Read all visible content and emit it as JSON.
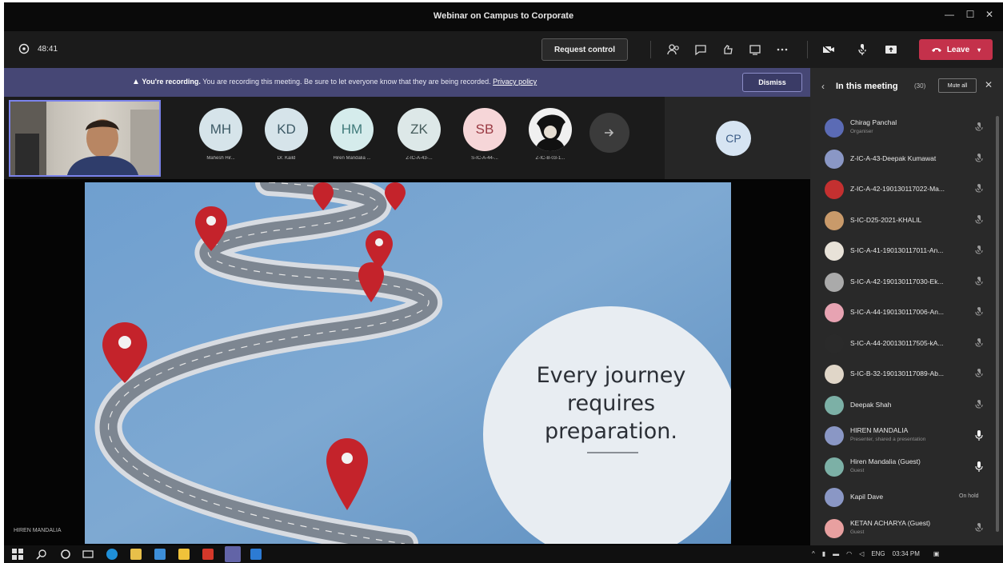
{
  "window": {
    "title": "Webinar on Campus to Corporate",
    "controls": [
      "—",
      "☐",
      "✕"
    ]
  },
  "toolbar": {
    "timer": "48:41",
    "request_control": "Request control",
    "leave": "Leave"
  },
  "banner": {
    "bold": "You're recording.",
    "message": "You are recording this meeting. Be sure to let everyone know that they are being recorded.",
    "link": "Privacy policy",
    "dismiss": "Dismiss"
  },
  "strip": {
    "participants": [
      {
        "initials": "MH",
        "name": "Mahesh Hir...",
        "bg": "#d6e4ea",
        "fg": "#3d5a66"
      },
      {
        "initials": "KD",
        "name": "Dr. Kaild",
        "bg": "#d6e4ea",
        "fg": "#3d5a66"
      },
      {
        "initials": "HM",
        "name": "Hiren Mandalia ...",
        "bg": "#d5ecec",
        "fg": "#3f7a7a"
      },
      {
        "initials": "ZK",
        "name": "Z-IC-A-43-...",
        "bg": "#dde8e8",
        "fg": "#455b5b"
      },
      {
        "initials": "SB",
        "name": "S-IC-A-44-...",
        "bg": "#f6d6d8",
        "fg": "#9a3a43"
      },
      {
        "initials": "",
        "name": "Z-IC-B-03-1...",
        "bg": "#f0f0f0",
        "fg": "#000"
      }
    ],
    "more_icon": "arrow-right-icon",
    "cp_initials": "CP"
  },
  "slide": {
    "line1": "Every journey",
    "line2": "requires",
    "line3": "preparation."
  },
  "presenter_label": "HIREN MANDALIA",
  "panel": {
    "title": "In this meeting",
    "count": "(30)",
    "mute_all": "Mute all",
    "people": [
      {
        "name": "Chirag Panchal",
        "sub": "Organiser",
        "mic": "muted",
        "av": "#5b6bb5"
      },
      {
        "name": "Z-IC-A-43-Deepak Kumawat",
        "sub": "",
        "mic": "muted",
        "av": "#8a97c5"
      },
      {
        "name": "Z-IC-A-42-190130117022-Ma...",
        "sub": "",
        "mic": "muted",
        "av": "#c43030"
      },
      {
        "name": "S-IC-D25-2021-KHALIL",
        "sub": "",
        "mic": "muted",
        "av": "#c99a6a"
      },
      {
        "name": "S-IC-A-41-190130117011-An...",
        "sub": "",
        "mic": "muted",
        "av": "#e8e2d8"
      },
      {
        "name": "S-IC-A-42-190130117030-Ek...",
        "sub": "",
        "mic": "muted",
        "av": "#aaaaaa"
      },
      {
        "name": "S-IC-A-44-190130117006-An...",
        "sub": "",
        "mic": "muted",
        "av": "#e7a3b2"
      },
      {
        "name": "S-IC-A-44-200130117505-kA...",
        "sub": "",
        "mic": "muted",
        "av": "#2a2a2a"
      },
      {
        "name": "S-IC-B-32-190130117089-Ab...",
        "sub": "",
        "mic": "muted",
        "av": "#e0d6c8"
      },
      {
        "name": "Deepak Shah",
        "sub": "",
        "mic": "muted",
        "av": "#7cb0a6"
      },
      {
        "name": "HIREN MANDALIA",
        "sub": "Presenter, shared a presentation",
        "mic": "on",
        "av": "#8a97c5"
      },
      {
        "name": "Hiren Mandalia (Guest)",
        "sub": "Guest",
        "mic": "on",
        "av": "#7cb0a6"
      },
      {
        "name": "Kapil Dave",
        "sub": "",
        "mic": "",
        "status": "On hold",
        "av": "#8a97c5"
      },
      {
        "name": "KETAN ACHARYA (Guest)",
        "sub": "Guest",
        "mic": "muted",
        "av": "#e8a0a0"
      }
    ]
  },
  "taskbar": {
    "tray_lang": "ENG",
    "tray_time": "03:34 PM"
  }
}
